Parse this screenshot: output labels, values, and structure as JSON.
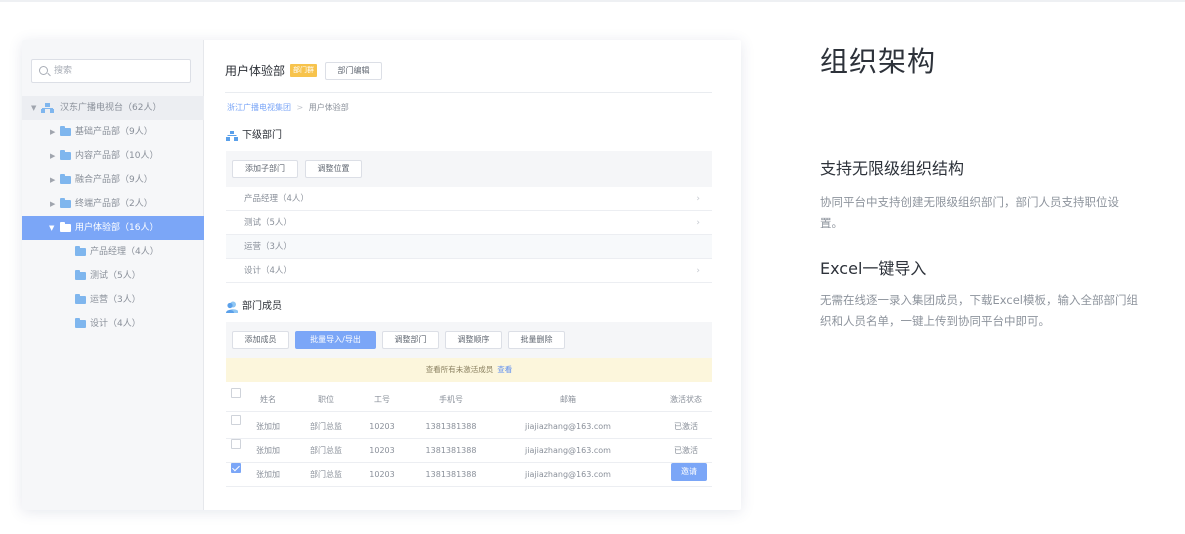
{
  "search": {
    "placeholder": "搜索"
  },
  "tree": {
    "root": "汉东广播电视台（62人）",
    "items": [
      "基础产品部（9人）",
      "内容产品部（10人）",
      "融合产品部（9人）",
      "终端产品部（2人）",
      "用户体验部（16人）"
    ],
    "children": [
      "产品经理（4人）",
      "测试（5人）",
      "运营（3人）",
      "设计（4人）"
    ]
  },
  "dept": {
    "title": "用户体验部",
    "badge": "部门群",
    "edit_button": "部门编辑"
  },
  "breadcrumb": {
    "parent": "浙江广播电视集团",
    "sep": ">",
    "current": "用户体验部"
  },
  "sub_section": {
    "title": "下级部门",
    "buttons": [
      "添加子部门",
      "调整位置"
    ],
    "rows": [
      "产品经理（4人）",
      "测试（5人）",
      "运营（3人）",
      "设计（4人）"
    ]
  },
  "members_section": {
    "title": "部门成员",
    "buttons": [
      "添加成员",
      "批量导入/导出",
      "调整部门",
      "调整顺序",
      "批量删除"
    ],
    "notice": "查看所有未激活成员",
    "notice_link": "查看",
    "columns": [
      "姓名",
      "职位",
      "工号",
      "手机号",
      "邮箱",
      "激活状态"
    ],
    "rows": [
      {
        "name": "张加加",
        "position": "部门总监",
        "id": "10203",
        "phone": "1381381388",
        "email": "jiajiazhang@163.com",
        "status": "已激活"
      },
      {
        "name": "张加加",
        "position": "部门总监",
        "id": "10203",
        "phone": "1381381388",
        "email": "jiajiazhang@163.com",
        "status": "已激活"
      },
      {
        "name": "张加加",
        "position": "部门总监",
        "id": "10203",
        "phone": "1381381388",
        "email": "jiajiazhang@163.com",
        "status": "邀请"
      }
    ]
  },
  "feature": {
    "heading": "组织架构",
    "items": [
      {
        "title": "支持无限级组织结构",
        "desc": "协同平台中支持创建无限级组织部门，部门人员支持职位设置。"
      },
      {
        "title": "Excel一键导入",
        "desc": "无需在线逐一录入集团成员，下载Excel模板，输入全部部门组织和人员名单，一键上传到协同平台中即可。"
      }
    ]
  },
  "colors": {
    "accent": "#7ba6f7",
    "badge": "#f7c34c",
    "notice_bg": "#fcf6dc"
  }
}
